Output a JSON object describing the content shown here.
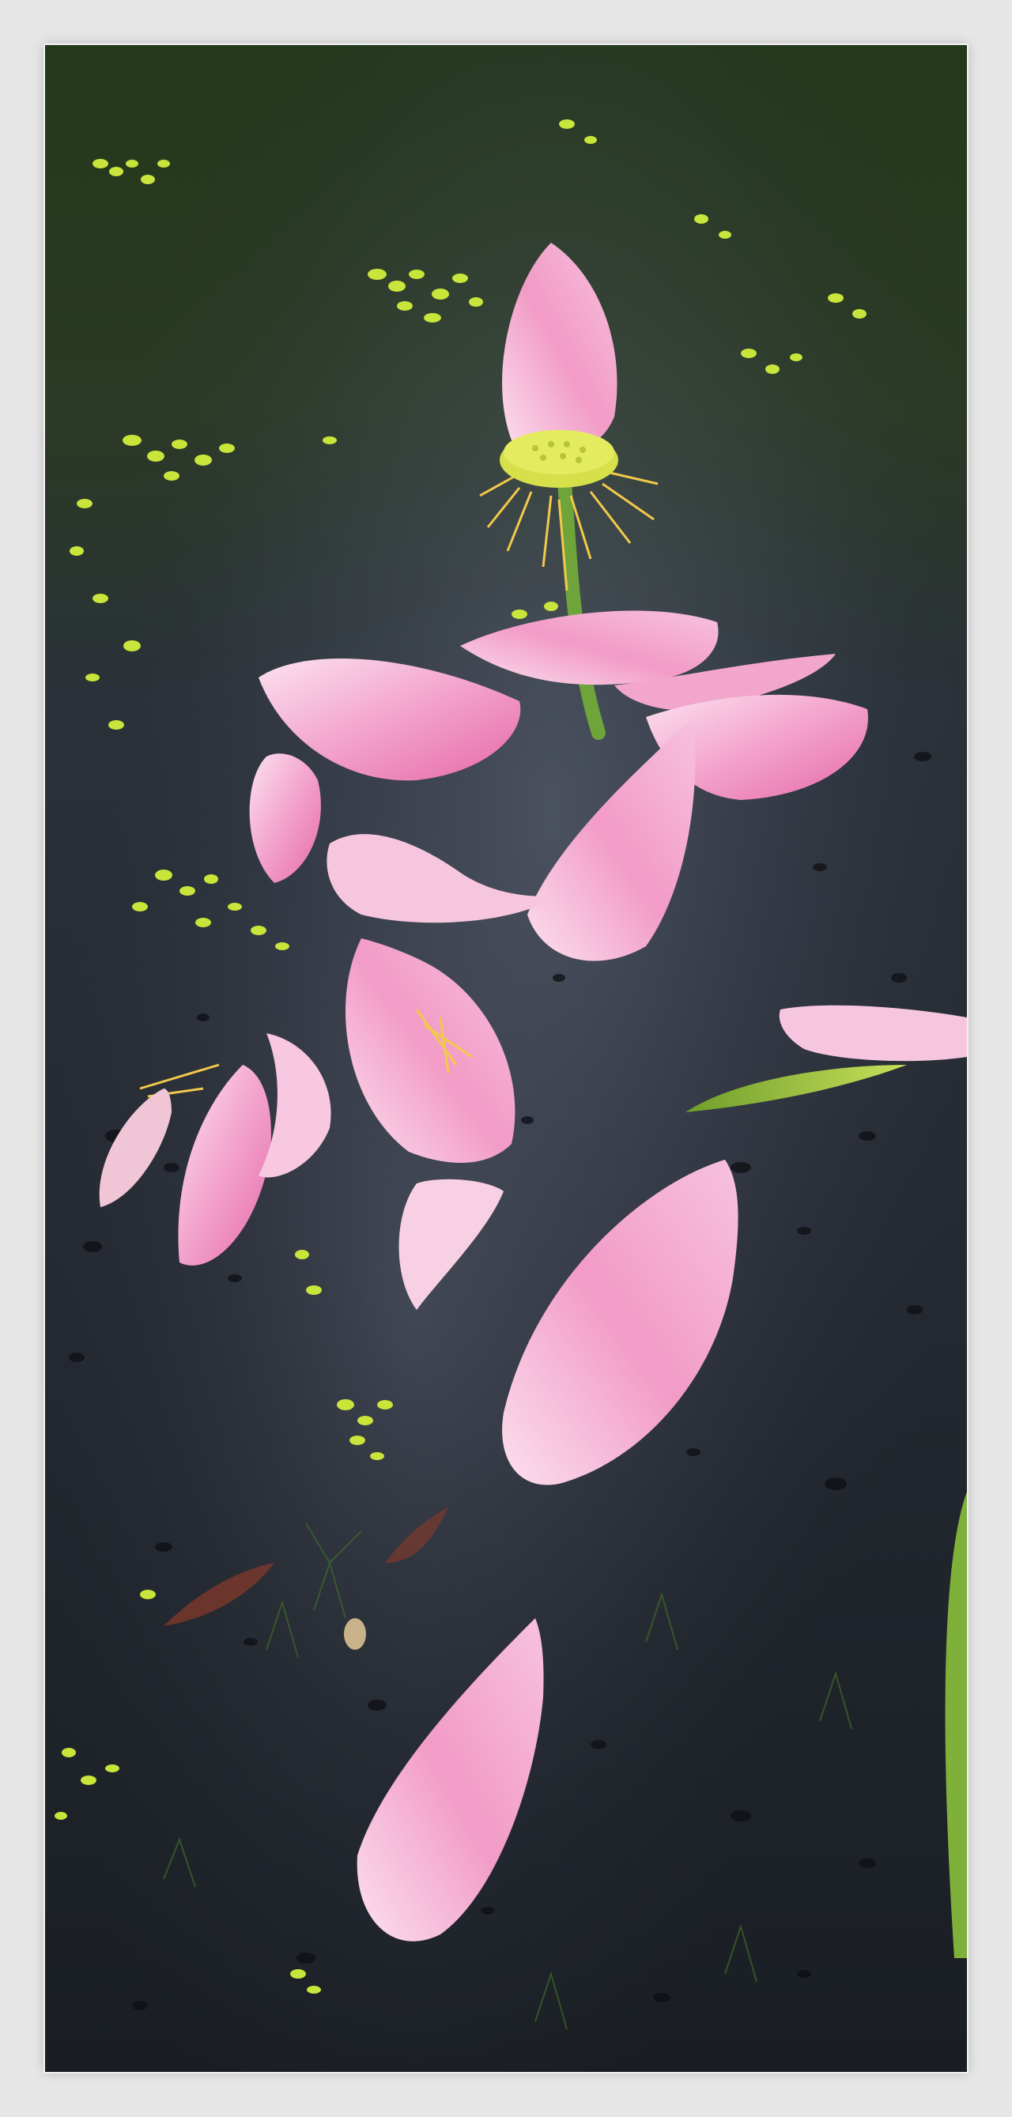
{
  "image": {
    "subject": "fallen-pink-lotus-petals-on-pond",
    "border_color": "#e6e6e6",
    "colors": {
      "water_dark": "#1c2027",
      "water_reflection": "#3a4250",
      "green_top": "#2f4a1c",
      "duckweed": "#c9e43a",
      "petal_pink": "#f29ec6",
      "petal_light": "#fbe0ee",
      "petal_edge": "#e56aa8",
      "seed_pod": "#d6e04a",
      "stamen": "#f2c94a",
      "stem": "#6ea43a",
      "leaf": "#9cc23a"
    }
  }
}
